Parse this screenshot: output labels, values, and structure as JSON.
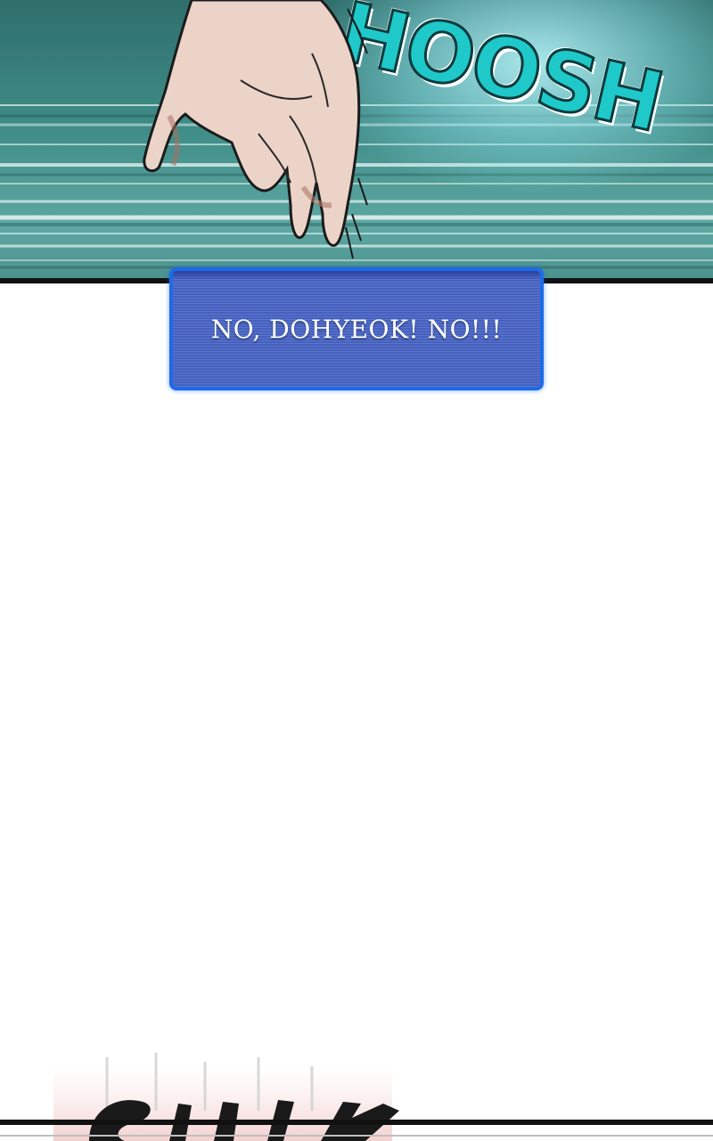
{
  "caption": {
    "text": "NO, DOHYEOK! NO!!!"
  },
  "sfx": {
    "top": "WHOOSH",
    "top_visible": "HOOSH"
  },
  "colors": {
    "panel_teal": "#3f8c87",
    "sfx_cyan": "#1fc9c9",
    "caption_fill": "#4a67c9",
    "caption_border": "#1e6be8",
    "skin": "#e9cfc4"
  },
  "icons": {
    "hand": "hand-illustration",
    "bottom_sfx": "sfx-lettering"
  }
}
